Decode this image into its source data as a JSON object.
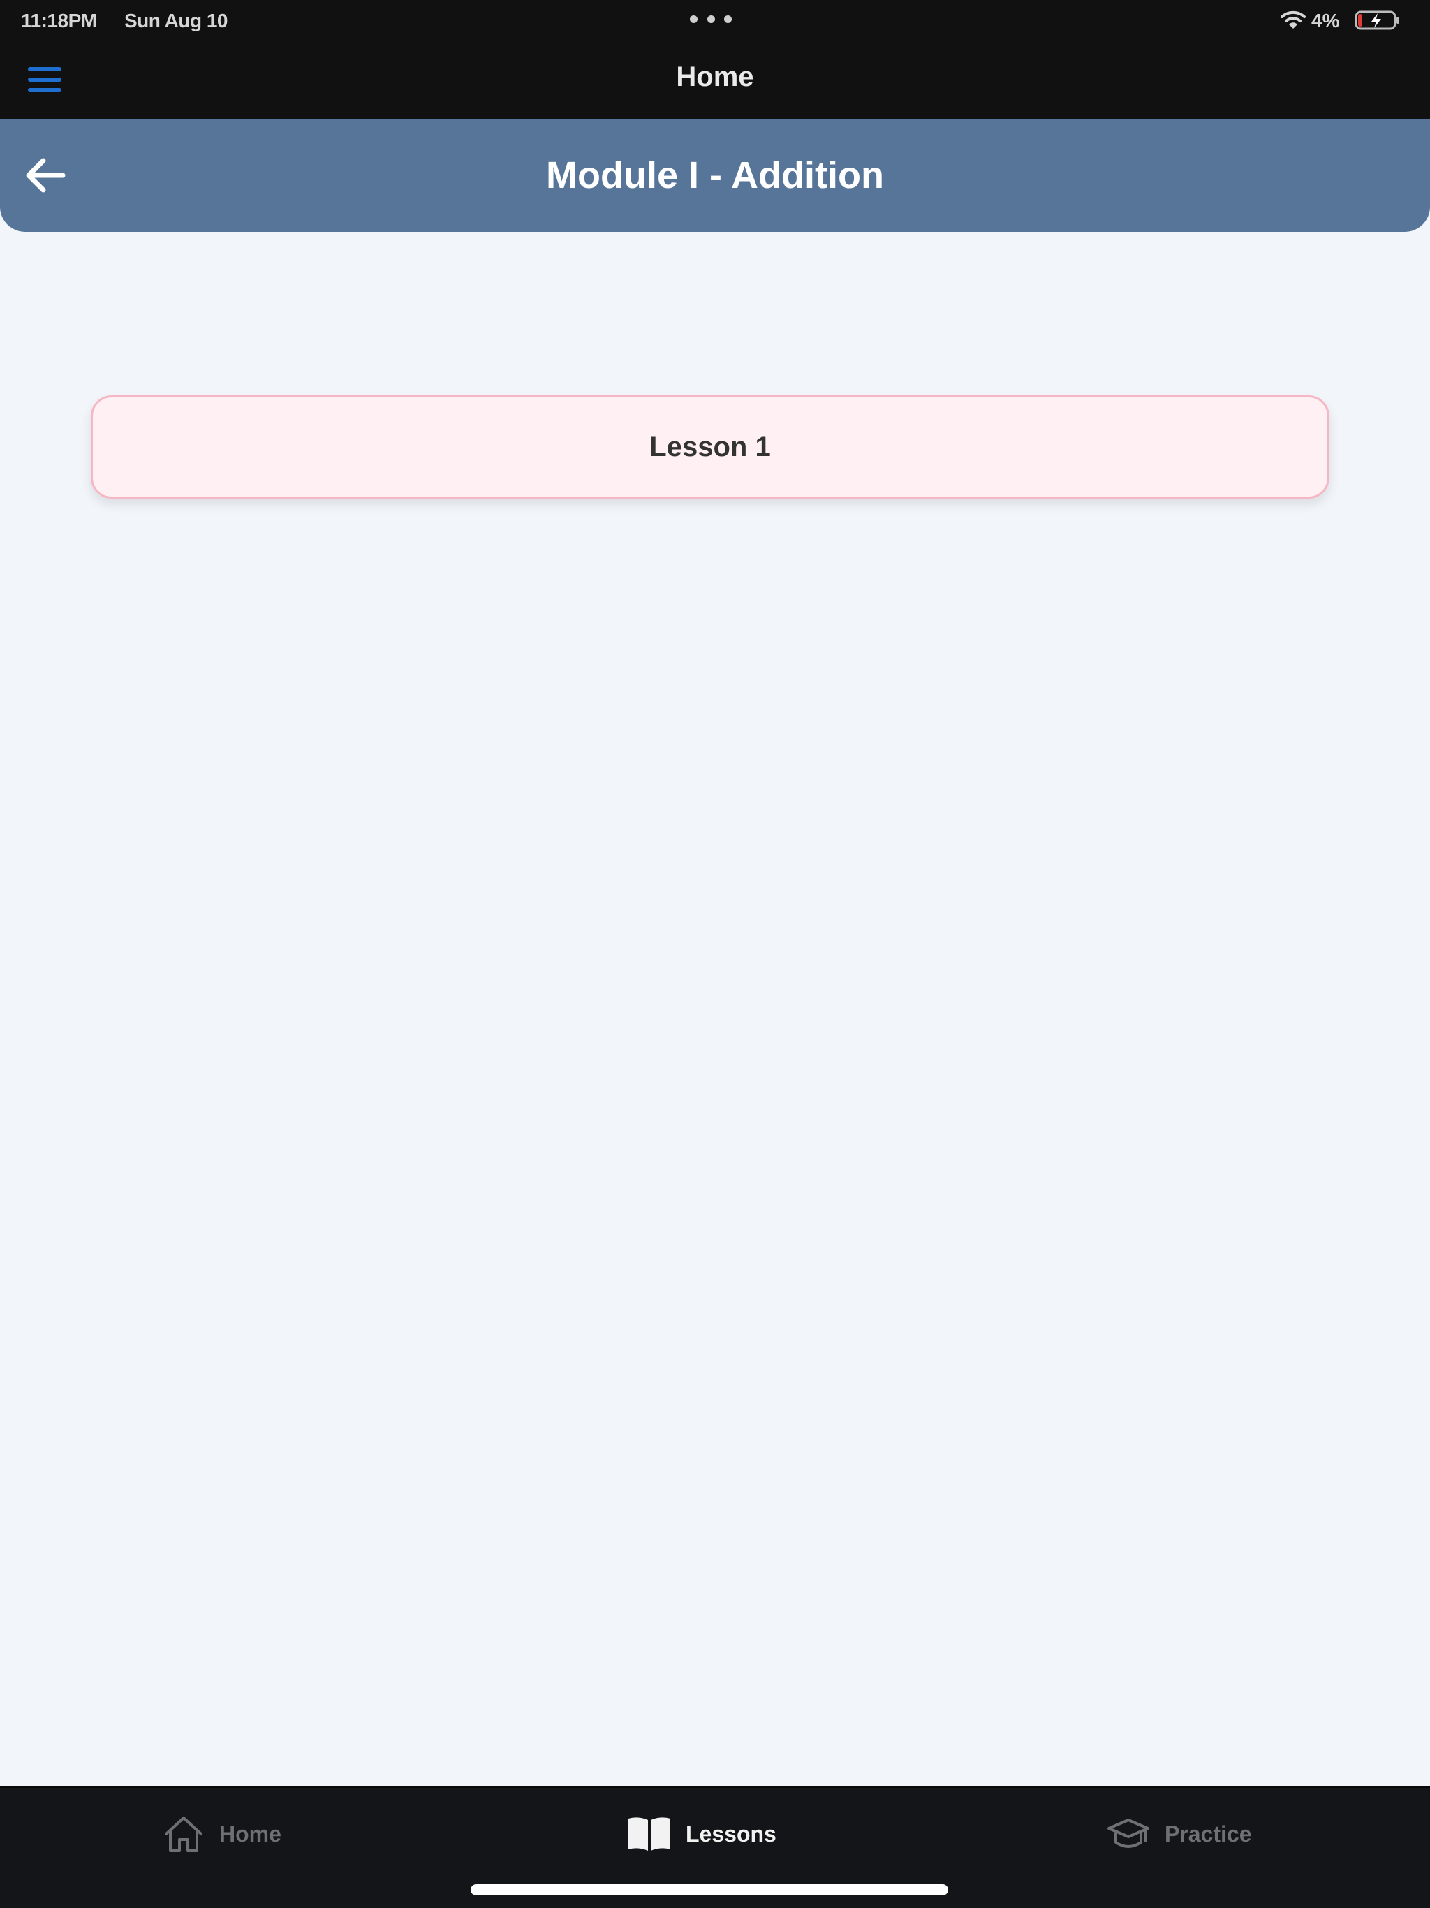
{
  "status_bar": {
    "time": "11:18PM",
    "date": "Sun Aug 10",
    "battery_percent": "4%",
    "battery_level": 0.04,
    "icons": [
      "wifi-icon",
      "battery-charging-icon"
    ]
  },
  "nav_bar": {
    "title": "Home",
    "menu_icon": "hamburger-menu-icon",
    "accent_color": "#1f6fd1"
  },
  "module_header": {
    "title": "Module I - Addition",
    "back_icon": "arrow-left-icon",
    "background_color": "#567598"
  },
  "lessons": [
    {
      "label": "Lesson 1"
    }
  ],
  "tab_bar": {
    "tabs": [
      {
        "label": "Home",
        "icon": "house-icon",
        "active": false
      },
      {
        "label": "Lessons",
        "icon": "open-book-icon",
        "active": true
      },
      {
        "label": "Practice",
        "icon": "graduation-cap-icon",
        "active": false
      }
    ]
  }
}
